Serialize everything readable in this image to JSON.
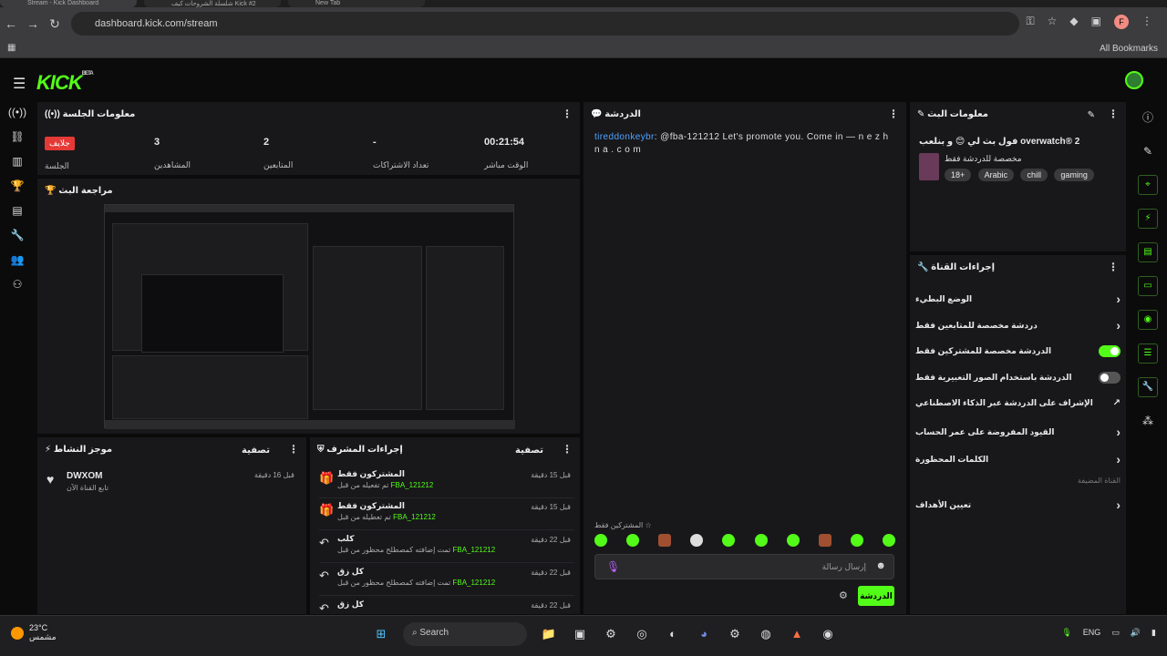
{
  "browser": {
    "tabs": [
      {
        "title": "Stream - Kick Dashboard"
      },
      {
        "title": "شلسلة الشروحات كيف Kick #2"
      },
      {
        "title": "New Tab"
      }
    ],
    "url": "dashboard.kick.com/stream",
    "all_bookmarks": "All Bookmarks",
    "profile_letter": "F"
  },
  "app": {
    "logo": "KICK",
    "beta": "BETA"
  },
  "session_info": {
    "title": "معلومات الجلسة",
    "live_badge": "جلايف",
    "session_label": "الجلسة",
    "stats": [
      {
        "value": "3",
        "label": "المشاهدين"
      },
      {
        "value": "2",
        "label": "المتابعين"
      },
      {
        "value": "-",
        "label": "تعداد الاشتراكات"
      },
      {
        "value": "00:21:54",
        "label": "الوقت مباشر"
      }
    ]
  },
  "stream_preview": {
    "title": "مراجعة البث"
  },
  "chat": {
    "title": "الدردشة",
    "message_user": "tireddonkeybr",
    "message_text": ": @fba-121212 Let's promote you. Come in — n e z h n a . c o m",
    "subscribers_only": "المشتركين فقط",
    "input_placeholder": "إرسال رسالة",
    "send_label": "الدردشة"
  },
  "stream_info": {
    "title": "معلومات البث",
    "stream_title": "فول بث لي 😊 و بنلعب overwatch® 2",
    "category": "مخصصة للدردشة فقط",
    "tags": [
      "18+",
      "Arabic",
      "chill",
      "gaming"
    ]
  },
  "channel_actions": {
    "title": "إجراءات القناة",
    "rows": [
      {
        "label": "الوضع البطيء",
        "control": "chevron"
      },
      {
        "label": "دردشة مخصصة للمتابعين فقط",
        "control": "chevron"
      },
      {
        "label": "الدردشة مخصصة للمشتركين فقط",
        "control": "toggle-on"
      },
      {
        "label": "الدردشة باستخدام الصور التعبيرية فقط",
        "control": "toggle-off"
      },
      {
        "label": "الإشراف على الدردشة عبر الذكاء الاصطناعي",
        "control": "external"
      },
      {
        "label": "القيود المفروضة على عمر الحساب",
        "control": "chevron"
      },
      {
        "label": "الكلمات المحظورة",
        "control": "chevron"
      }
    ],
    "section_label": "القناة المضيفة",
    "target_label": "تعيين الأهداف"
  },
  "activity": {
    "title": "موجز النشاط",
    "filter": "تصفية",
    "item_user": "DWXOM",
    "item_text": "تابع القناة الآن",
    "item_time": "قبل 16 دقيقة"
  },
  "mod_actions": {
    "title": "إجراءات المشرف",
    "filter": "تصفية",
    "items": [
      {
        "icon": "gift-icon",
        "title": "المشتركون فقط",
        "desc": "تم تفعيله من قبل",
        "user": "FBA_121212",
        "time": "قبل 15 دقيقة"
      },
      {
        "icon": "gift-icon",
        "title": "المشتركون فقط",
        "desc": "تم تعطيله من قبل",
        "user": "FBA_121212",
        "time": "قبل 15 دقيقة"
      },
      {
        "icon": "undo-icon",
        "title": "كلب",
        "desc": "تمت إضافته كمصطلح محظور من قبل",
        "user": "FBA_121212",
        "time": "قبل 22 دقيقة"
      },
      {
        "icon": "undo-icon",
        "title": "كل زق",
        "desc": "تمت إضافته كمصطلح محظور من قبل",
        "user": "FBA_121212",
        "time": "قبل 22 دقيقة"
      },
      {
        "icon": "undo-icon",
        "title": "كل زق",
        "desc": "",
        "user": "",
        "time": "قبل 22 دقيقة"
      }
    ]
  },
  "taskbar": {
    "temp": "23°C",
    "condition": "مشمس",
    "search": "Search",
    "lang": "ENG"
  }
}
